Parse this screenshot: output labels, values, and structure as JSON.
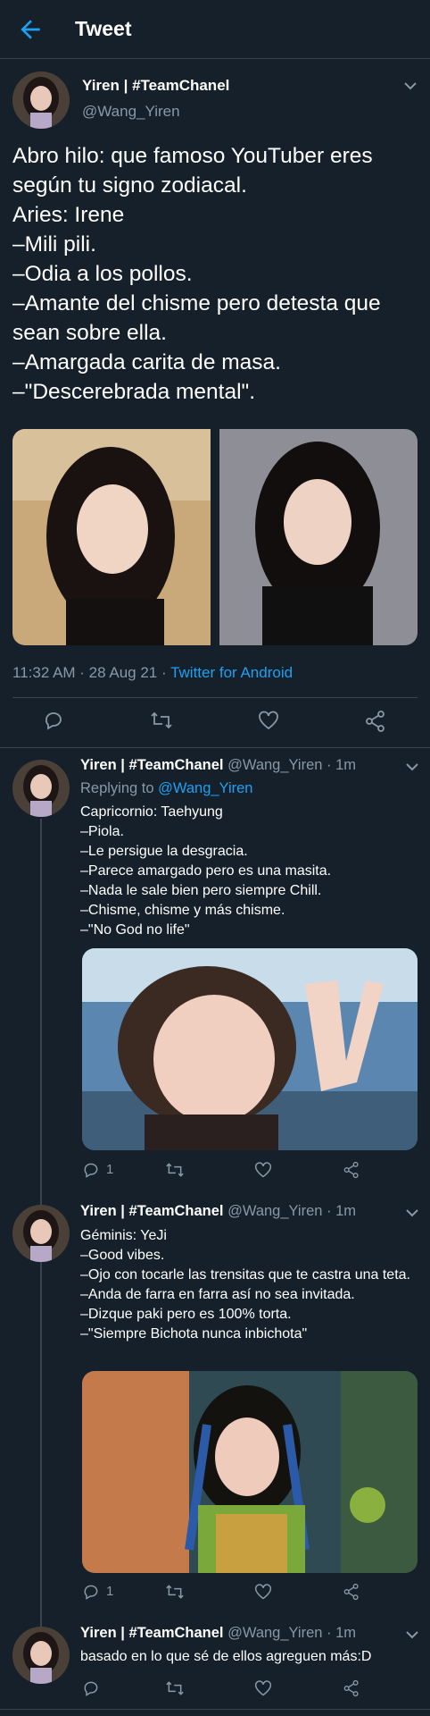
{
  "header": {
    "title": "Tweet"
  },
  "main_tweet": {
    "display_name": "Yiren | #TeamChanel",
    "handle": "@Wang_Yiren",
    "text": "Abro hilo: que famoso YouTuber eres según tu signo zodiacal.\nAries: Irene\n–Mili pili.\n–Odia a los pollos.\n–Amante del chisme pero detesta que sean sobre ella.\n–Amargada carita de masa.\n–\"Descerebrada mental\".",
    "meta_time": "11:32 AM · 28 Aug 21 · ",
    "meta_source": "Twitter for Android"
  },
  "replies": [
    {
      "display_name": "Yiren | #TeamChanel",
      "handle_time": "@Wang_Yiren · 1m",
      "replying_prefix": "Replying to ",
      "replying_handle": "@Wang_Yiren",
      "text": "Capricornio: Taehyung\n–Piola.\n–Le persigue la desgracia.\n–Parece amargado pero es una masita.\n–Nada le sale bien pero siempre Chill.\n–Chisme, chisme y más chisme.\n–\"No God no life\"",
      "reply_count": "1"
    },
    {
      "display_name": "Yiren | #TeamChanel",
      "handle_time": "@Wang_Yiren · 1m",
      "text": "Géminis: YeJi\n–Good vibes.\n–Ojo con tocarle las trensitas que te castra una teta.\n–Anda de farra en farra así no sea invitada.\n–Dizque paki pero es 100% torta.\n–\"Siempre Bichota nunca inbichota\"",
      "reply_count": "1"
    },
    {
      "display_name": "Yiren | #TeamChanel",
      "handle_time": "@Wang_Yiren · 1m",
      "text": "basado en lo que sé de ellos agreguen más:D"
    }
  ],
  "colors": {
    "background": "#15202b",
    "accent": "#1da1f2",
    "muted": "#8899a6",
    "border": "#38444d"
  },
  "icons": [
    "back-arrow-icon",
    "chevron-down-icon",
    "reply-icon",
    "retweet-icon",
    "like-icon",
    "share-icon"
  ]
}
